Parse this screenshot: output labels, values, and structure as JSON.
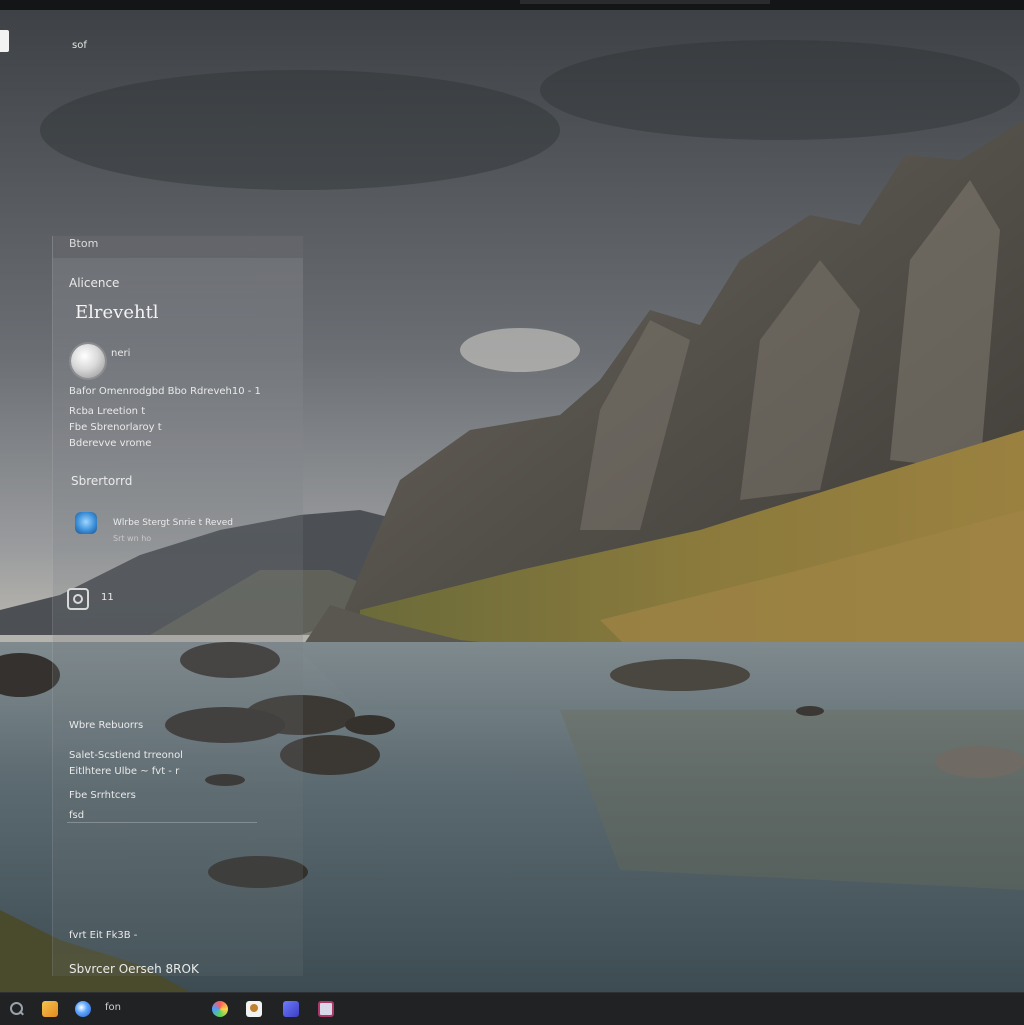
{
  "desktop": {
    "corner_label": "sof"
  },
  "panel": {
    "header": "Btom",
    "section_label": "Alicence",
    "title": "Elrevehtl",
    "profile_name": "neri",
    "info_lines": [
      "Bafor Omenrodgbd Bbo Rdreveh10 - 1",
      "Rcba Lreetion t",
      "Fbe Sbrenorlaroy t",
      "Bderevve vrome"
    ],
    "action_label": "Sbrertorrd",
    "app_primary": "Wlrbe Stergt Snrie t Reved",
    "app_secondary": "Srt wn ho",
    "settings_label": "11",
    "list_items": [
      "Wbre Rebuorrs",
      "Salet-Scstiend trreonol",
      "Eitlhtere Ulbe ~ fvt - r",
      "Fbe Srrhtcers",
      "fsd"
    ],
    "footer_small": "fvrt Eit Fk3B -",
    "footer_main": "Sbvrcer Oerseh 8ROK"
  },
  "taskbar": {
    "label": "fon"
  }
}
